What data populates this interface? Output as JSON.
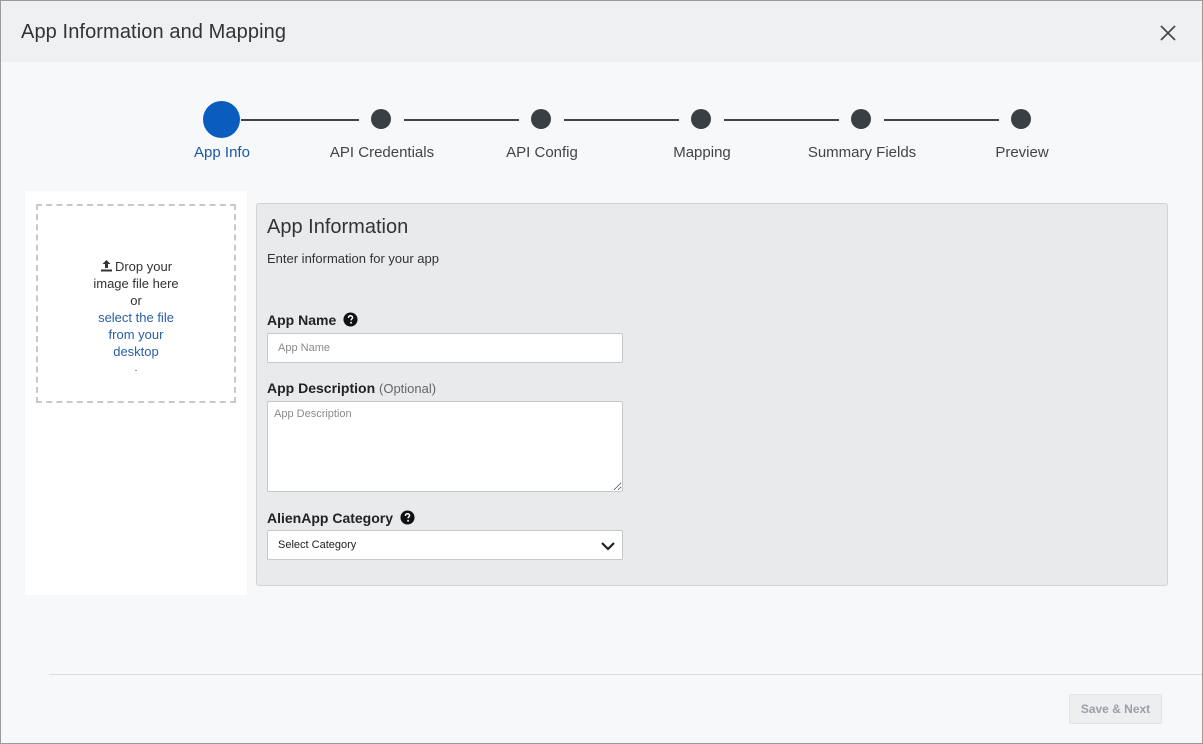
{
  "modal": {
    "title": "App Information and Mapping"
  },
  "stepper": {
    "steps": [
      {
        "label": "App Info",
        "active": true
      },
      {
        "label": "API Credentials",
        "active": false
      },
      {
        "label": "API Config",
        "active": false
      },
      {
        "label": "Mapping",
        "active": false
      },
      {
        "label": "Summary Fields",
        "active": false
      },
      {
        "label": "Preview",
        "active": false
      }
    ]
  },
  "dropzone": {
    "line1": "Drop your",
    "line2": "image file here",
    "line3": "or",
    "link_line1": "select the file",
    "link_line2": "from your",
    "link_line3": "desktop",
    "trailing": "."
  },
  "form": {
    "title": "App Information",
    "subtitle": "Enter information for your app",
    "app_name_label": "App Name",
    "app_name_placeholder": "App Name",
    "app_name_value": "",
    "app_description_label": "App Description",
    "app_description_optional": "(Optional)",
    "app_description_placeholder": "App Description",
    "category_label": "AlienApp Category",
    "category_selected": "Select Category"
  },
  "footer": {
    "save_next_label": "Save & Next"
  },
  "colors": {
    "accent": "#0b5cbf",
    "step_inactive": "#3a3f44",
    "link": "#2a5ea8"
  },
  "icons": {
    "close": "close-icon",
    "upload": "upload-icon",
    "help": "question-circle-icon",
    "chevron": "chevron-down-icon"
  }
}
